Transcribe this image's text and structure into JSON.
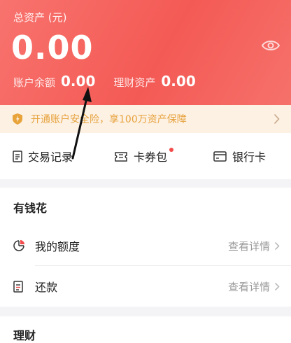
{
  "assets": {
    "total_label": "总资产 (元)",
    "total_amount": "0.00",
    "balance_label": "账户余额",
    "balance_value": "0.00",
    "wealth_label": "理财资产",
    "wealth_value": "0.00"
  },
  "banner": {
    "text": "开通账户安全险，享100万资产保障"
  },
  "quick_actions": [
    {
      "label": "交易记录",
      "icon": "document-list-icon"
    },
    {
      "label": "卡券包",
      "icon": "coupon-icon",
      "badge": true
    },
    {
      "label": "银行卡",
      "icon": "bank-card-icon"
    }
  ],
  "youqianhua": {
    "title": "有钱花",
    "rows": [
      {
        "label": "我的额度",
        "detail": "查看详情",
        "icon": "quota-pie-icon"
      },
      {
        "label": "还款",
        "detail": "查看详情",
        "icon": "repay-document-icon"
      }
    ]
  },
  "licai": {
    "title": "理财"
  },
  "colors": {
    "header_red": "#f45a55",
    "banner_bg": "#fdf1e4",
    "banner_text": "#e6a23c",
    "badge_red": "#f44a4a"
  }
}
